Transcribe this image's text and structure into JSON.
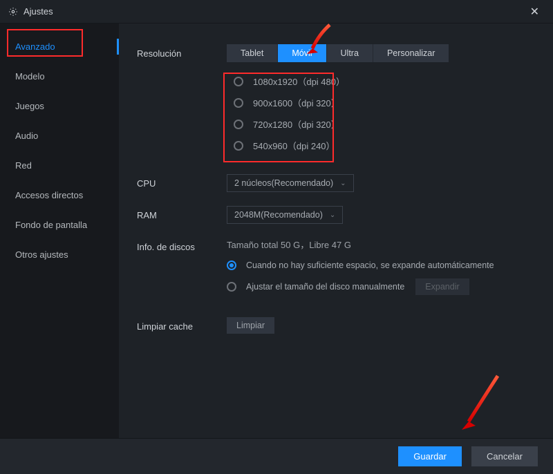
{
  "window": {
    "title": "Ajustes"
  },
  "sidebar": {
    "items": [
      {
        "label": "Avanzado",
        "active": true
      },
      {
        "label": "Modelo"
      },
      {
        "label": "Juegos"
      },
      {
        "label": "Audio"
      },
      {
        "label": "Red"
      },
      {
        "label": "Accesos directos"
      },
      {
        "label": "Fondo de pantalla"
      },
      {
        "label": "Otros ajustes"
      }
    ]
  },
  "resolution": {
    "label": "Resolución",
    "tabs": [
      {
        "label": "Tablet"
      },
      {
        "label": "Móvil",
        "active": true
      },
      {
        "label": "Ultra"
      },
      {
        "label": "Personalizar"
      }
    ],
    "options": [
      {
        "label": "1080x1920（dpi 480）"
      },
      {
        "label": "900x1600（dpi 320）"
      },
      {
        "label": "720x1280（dpi 320）"
      },
      {
        "label": "540x960（dpi 240）"
      }
    ]
  },
  "cpu": {
    "label": "CPU",
    "value": "2 núcleos(Recomendado)"
  },
  "ram": {
    "label": "RAM",
    "value": "2048M(Recomendado)"
  },
  "disk": {
    "label": "Info. de discos",
    "summary": "Tamaño total 50 G，Libre 47 G",
    "option_auto": "Cuando no hay suficiente espacio, se expande automáticamente",
    "option_manual": "Ajustar el tamaño del disco manualmente",
    "expand_btn": "Expandir"
  },
  "cache": {
    "label": "Limpiar cache",
    "btn": "Limpiar"
  },
  "footer": {
    "save": "Guardar",
    "cancel": "Cancelar"
  }
}
